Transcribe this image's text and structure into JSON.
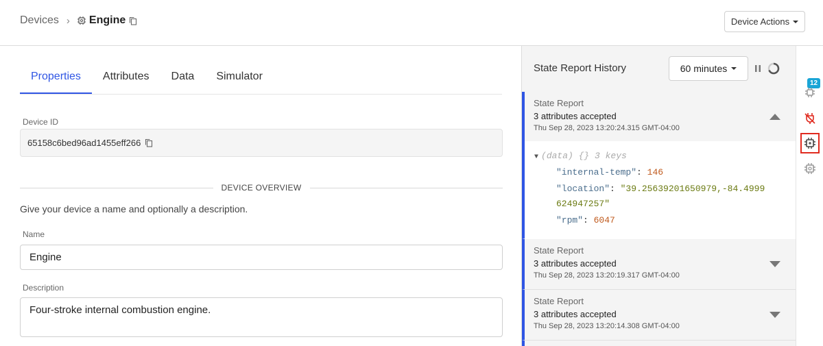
{
  "header": {
    "breadcrumb_root": "Devices",
    "breadcrumb_sep": "›",
    "device_name": "Engine",
    "actions_label": "Device Actions"
  },
  "tabs": [
    {
      "label": "Properties",
      "active": true
    },
    {
      "label": "Attributes",
      "active": false
    },
    {
      "label": "Data",
      "active": false
    },
    {
      "label": "Simulator",
      "active": false
    }
  ],
  "properties": {
    "device_id_label": "Device ID",
    "device_id": "65158c6bed96ad1455eff266",
    "overview_title": "DEVICE OVERVIEW",
    "overview_helper": "Give your device a name and optionally a description.",
    "name_label": "Name",
    "name_value": "Engine",
    "description_label": "Description",
    "description_value": "Four-stroke internal combustion engine."
  },
  "history": {
    "title": "State Report History",
    "range": "60 minutes",
    "reports": [
      {
        "title": "State Report",
        "subtitle": "3 attributes accepted",
        "time": "Thu Sep 28, 2023 13:20:24.315 GMT-04:00",
        "expanded": true,
        "json_header": "(data) {} 3 keys",
        "json": [
          {
            "key": "\"internal-temp\"",
            "value": "146",
            "type": "num"
          },
          {
            "key": "\"location\"",
            "value": "\"39.25639201650979,-84.4999",
            "value_cont": "624947257\"",
            "type": "str"
          },
          {
            "key": "\"rpm\"",
            "value": "6047",
            "type": "num"
          }
        ]
      },
      {
        "title": "State Report",
        "subtitle": "3 attributes accepted",
        "time": "Thu Sep 28, 2023 13:20:19.317 GMT-04:00",
        "expanded": false
      },
      {
        "title": "State Report",
        "subtitle": "3 attributes accepted",
        "time": "Thu Sep 28, 2023 13:20:14.308 GMT-04:00",
        "expanded": false
      }
    ]
  },
  "rail": {
    "badge_count": "12",
    "items": [
      "notifications-icon",
      "disconnected-plug-icon",
      "device-chip-icon",
      "device-chip-settings-icon"
    ]
  },
  "colors": {
    "accent": "#2f55e4",
    "badge": "#1aa5d6",
    "alert": "#e02a1f"
  }
}
